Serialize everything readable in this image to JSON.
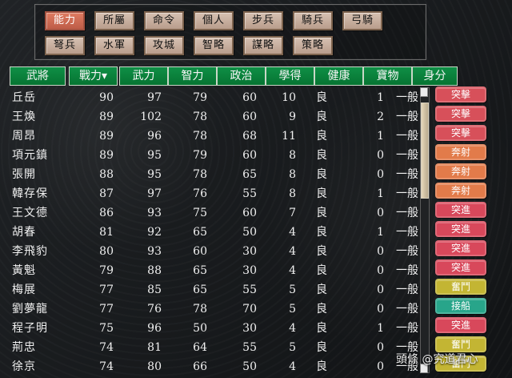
{
  "top_buttons": [
    {
      "label": "能力",
      "active": true
    },
    {
      "label": "所屬",
      "active": false
    },
    {
      "label": "命令",
      "active": false
    },
    {
      "label": "個人",
      "active": false
    },
    {
      "label": "步兵",
      "active": false
    },
    {
      "label": "騎兵",
      "active": false
    },
    {
      "label": "弓騎",
      "active": false
    },
    {
      "label": "弩兵",
      "active": false
    },
    {
      "label": "水軍",
      "active": false
    },
    {
      "label": "攻城",
      "active": false
    },
    {
      "label": "智略",
      "active": false
    },
    {
      "label": "謀略",
      "active": false
    },
    {
      "label": "策略",
      "active": false
    }
  ],
  "columns": [
    "武將",
    "戰力▾",
    "武力",
    "智力",
    "政治",
    "學得",
    "健康",
    "寶物",
    "身分"
  ],
  "rows": [
    {
      "name": "丘岳",
      "war": "90",
      "force": "97",
      "intel": "79",
      "politics": "60",
      "learn": "10",
      "health": "良",
      "treasure": "1",
      "status": "一般",
      "skill": "突擊",
      "skill_color": "#d7505a"
    },
    {
      "name": "王煥",
      "war": "89",
      "force": "102",
      "intel": "78",
      "politics": "60",
      "learn": "9",
      "health": "良",
      "treasure": "2",
      "status": "一般",
      "skill": "突擊",
      "skill_color": "#d7505a"
    },
    {
      "name": "周昂",
      "war": "89",
      "force": "96",
      "intel": "78",
      "politics": "68",
      "learn": "11",
      "health": "良",
      "treasure": "1",
      "status": "一般",
      "skill": "突擊",
      "skill_color": "#d7505a"
    },
    {
      "name": "項元鎮",
      "war": "89",
      "force": "95",
      "intel": "79",
      "politics": "60",
      "learn": "8",
      "health": "良",
      "treasure": "0",
      "status": "一般",
      "skill": "奔射",
      "skill_color": "#e27b4a"
    },
    {
      "name": "張開",
      "war": "88",
      "force": "95",
      "intel": "78",
      "politics": "65",
      "learn": "8",
      "health": "良",
      "treasure": "0",
      "status": "一般",
      "skill": "奔射",
      "skill_color": "#e27b4a"
    },
    {
      "name": "韓存保",
      "war": "87",
      "force": "97",
      "intel": "76",
      "politics": "55",
      "learn": "8",
      "health": "良",
      "treasure": "1",
      "status": "一般",
      "skill": "奔射",
      "skill_color": "#e27b4a"
    },
    {
      "name": "王文德",
      "war": "86",
      "force": "93",
      "intel": "75",
      "politics": "60",
      "learn": "7",
      "health": "良",
      "treasure": "0",
      "status": "一般",
      "skill": "突進",
      "skill_color": "#d8485b"
    },
    {
      "name": "胡春",
      "war": "81",
      "force": "92",
      "intel": "65",
      "politics": "50",
      "learn": "4",
      "health": "良",
      "treasure": "1",
      "status": "一般",
      "skill": "突進",
      "skill_color": "#d8485b"
    },
    {
      "name": "李飛豹",
      "war": "80",
      "force": "93",
      "intel": "60",
      "politics": "30",
      "learn": "4",
      "health": "良",
      "treasure": "0",
      "status": "一般",
      "skill": "突進",
      "skill_color": "#d8485b"
    },
    {
      "name": "黃魁",
      "war": "79",
      "force": "88",
      "intel": "65",
      "politics": "30",
      "learn": "4",
      "health": "良",
      "treasure": "0",
      "status": "一般",
      "skill": "突進",
      "skill_color": "#d8485b"
    },
    {
      "name": "梅展",
      "war": "77",
      "force": "85",
      "intel": "65",
      "politics": "55",
      "learn": "5",
      "health": "良",
      "treasure": "0",
      "status": "一般",
      "skill": "奮鬥",
      "skill_color": "#c3b533"
    },
    {
      "name": "劉夢龍",
      "war": "77",
      "force": "76",
      "intel": "78",
      "politics": "70",
      "learn": "5",
      "health": "良",
      "treasure": "0",
      "status": "一般",
      "skill": "接船",
      "skill_color": "#28a58a"
    },
    {
      "name": "程子明",
      "war": "75",
      "force": "96",
      "intel": "50",
      "politics": "30",
      "learn": "4",
      "health": "良",
      "treasure": "1",
      "status": "一般",
      "skill": "突進",
      "skill_color": "#d8485b"
    },
    {
      "name": "荊忠",
      "war": "74",
      "force": "81",
      "intel": "64",
      "politics": "55",
      "learn": "5",
      "health": "良",
      "treasure": "0",
      "status": "一般",
      "skill": "奮鬥",
      "skill_color": "#c3b533"
    },
    {
      "name": "徐京",
      "war": "74",
      "force": "80",
      "intel": "66",
      "politics": "50",
      "learn": "4",
      "health": "良",
      "treasure": "0",
      "status": "一般",
      "skill": "奮鬥",
      "skill_color": "#c3b533"
    }
  ],
  "watermark": "頭條 @究道君心"
}
